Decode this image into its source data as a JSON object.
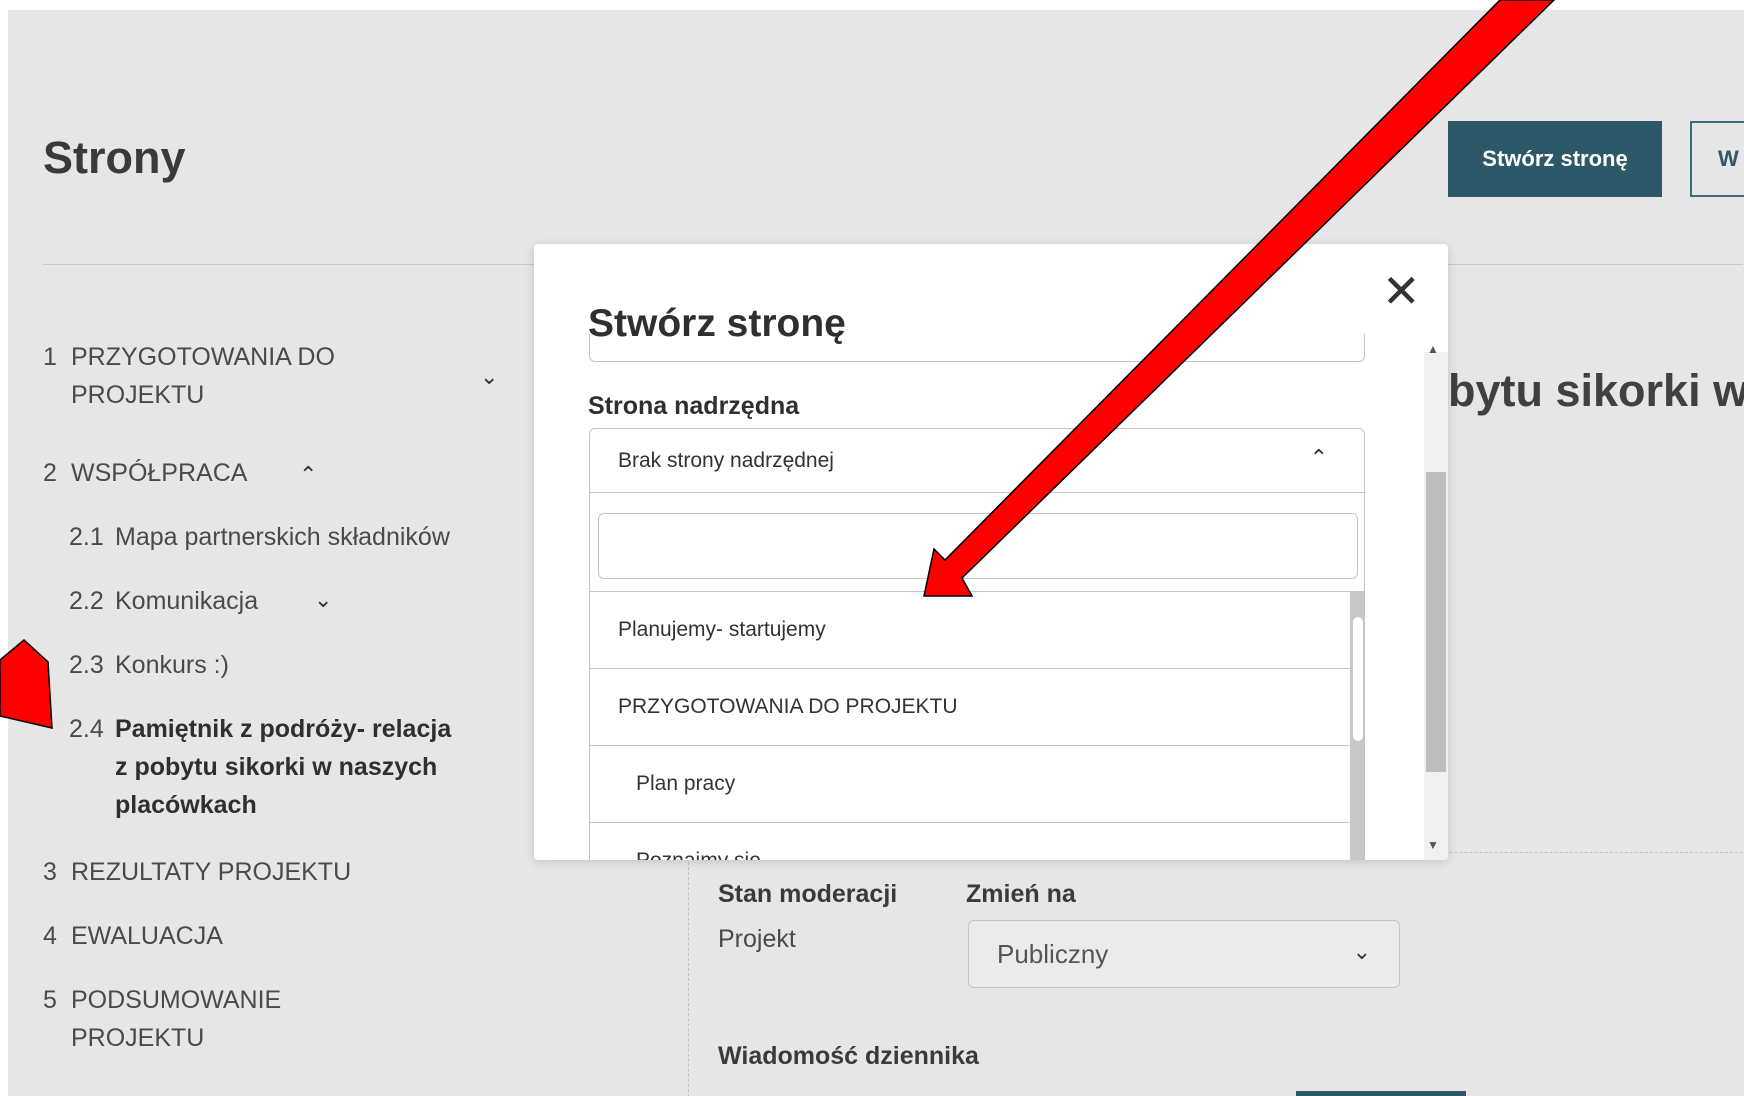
{
  "page": {
    "title": "Strony",
    "create_button": "Stwórz stronę",
    "second_button": "W"
  },
  "sidebar": {
    "items": [
      {
        "num": "1",
        "label_line1": "PRZYGOTOWANIA DO",
        "label_line2": "PROJEKTU"
      },
      {
        "num": "2",
        "label": "WSPÓŁPRACA"
      },
      {
        "num": "2.1",
        "label": "Mapa partnerskich składników"
      },
      {
        "num": "2.2",
        "label": "Komunikacja"
      },
      {
        "num": "2.3",
        "label": "Konkurs :)"
      },
      {
        "num": "2.4",
        "label_line1": "Pamiętnik z podróży- relacja",
        "label_line2": "z pobytu sikorki w naszych",
        "label_line3": "placówkach"
      },
      {
        "num": "3",
        "label": "REZULTATY PROJEKTU"
      },
      {
        "num": "4",
        "label": "EWALUACJA"
      },
      {
        "num": "5",
        "label_line1": "PODSUMOWANIE",
        "label_line2": "PROJEKTU"
      }
    ]
  },
  "main": {
    "heading_partial": "bytu sikorki w",
    "moderation_label": "Stan moderacji",
    "change_to_label": "Zmień na",
    "moderation_value": "Projekt",
    "change_to_value": "Publiczny",
    "log_message_label": "Wiadomość dziennika"
  },
  "modal": {
    "title": "Stwórz stronę",
    "parent_label": "Strona nadrzędna",
    "parent_selected": "Brak strony nadrzędnej",
    "search_value": "",
    "options": [
      {
        "label": "Planujemy- startujemy"
      },
      {
        "label": "PRZYGOTOWANIA DO PROJEKTU"
      },
      {
        "label": "Plan pracy"
      },
      {
        "label": "Poznajmy się"
      }
    ]
  },
  "colors": {
    "primary": "#2d5868",
    "page_background": "#e6e6e6",
    "annotation_arrow": "#ff0000"
  },
  "icons": {
    "close": "close-icon",
    "chevron_down": "chevron-down-icon",
    "chevron_up": "chevron-up-icon"
  }
}
